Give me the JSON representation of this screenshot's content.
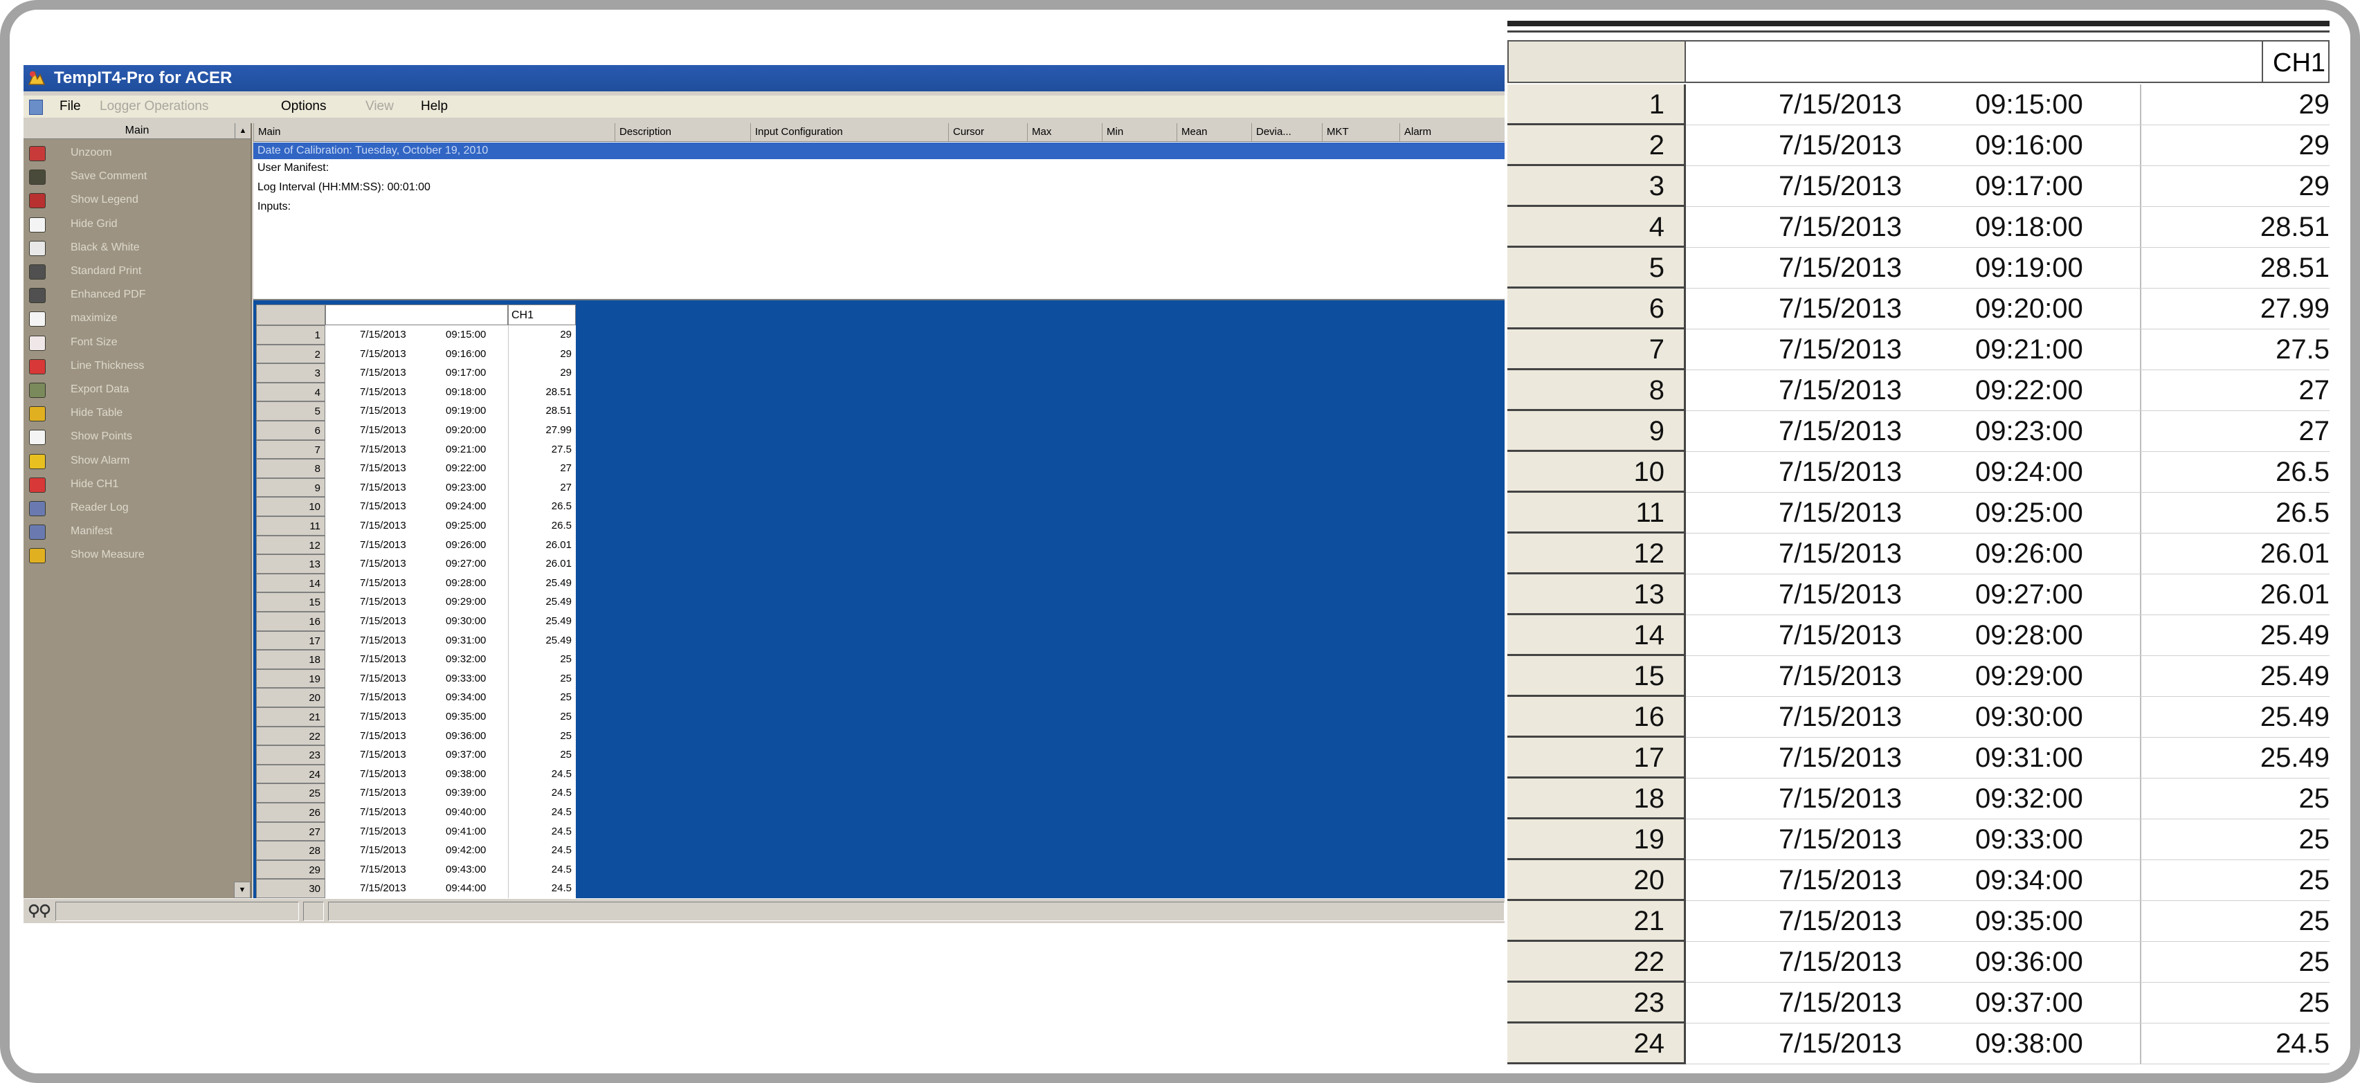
{
  "window": {
    "title": "TempIT4-Pro for ACER"
  },
  "menu": {
    "file": "File",
    "logger_operations": "Logger Operations",
    "options": "Options",
    "view": "View",
    "help": "Help"
  },
  "sidebar": {
    "header": "Main",
    "items": [
      {
        "label": "Unzoom",
        "icon": "magnifier-icon",
        "color": "#c83a3a"
      },
      {
        "label": "Save Comment",
        "icon": "comment-icon",
        "color": "#4a4a3a"
      },
      {
        "label": "Show Legend",
        "icon": "legend-icon",
        "color": "#b83030"
      },
      {
        "label": "Hide Grid",
        "icon": "grid-icon",
        "color": "#f4f4f4"
      },
      {
        "label": "Black & White",
        "icon": "black-white-icon",
        "color": "#e8e8e8"
      },
      {
        "label": "Standard Print",
        "icon": "printer-icon",
        "color": "#505050"
      },
      {
        "label": "Enhanced PDF",
        "icon": "pdf-printer-icon",
        "color": "#505050"
      },
      {
        "label": "maximize",
        "icon": "maximize-icon",
        "color": "#f4f4f4"
      },
      {
        "label": "Font Size",
        "icon": "font-size-icon",
        "color": "#f0e8e8"
      },
      {
        "label": "Line Thickness",
        "icon": "line-thickness-icon",
        "color": "#d83838"
      },
      {
        "label": "Export Data",
        "icon": "export-icon",
        "color": "#7a8a5a"
      },
      {
        "label": "Hide Table",
        "icon": "table-icon",
        "color": "#e0b020"
      },
      {
        "label": "Show Points",
        "icon": "points-icon",
        "color": "#f4f4f4"
      },
      {
        "label": "Show Alarm",
        "icon": "alarm-icon",
        "color": "#e8c020"
      },
      {
        "label": "Hide CH1",
        "icon": "channel-icon",
        "color": "#d83838"
      },
      {
        "label": "Reader Log",
        "icon": "reader-log-icon",
        "color": "#6a7ab0"
      },
      {
        "label": "Manifest",
        "icon": "manifest-icon",
        "color": "#6a7ab0"
      },
      {
        "label": "Show Measure",
        "icon": "measure-icon",
        "color": "#e0b020"
      }
    ]
  },
  "columns": [
    "Main",
    "Description",
    "Input Configuration",
    "Cursor",
    "Max",
    "Min",
    "Mean",
    "Devia...",
    "MKT",
    "Alarm"
  ],
  "info": {
    "calibration": "Date of Calibration: Tuesday, October 19, 2010",
    "manifest": "User Manifest:",
    "log_interval": "Log Interval (HH:MM:SS): 00:01:00",
    "inputs": "Inputs:"
  },
  "table": {
    "channel_header": "CH1",
    "rows": [
      {
        "n": "1",
        "date": "7/15/2013",
        "time": "09:15:00",
        "value": "29"
      },
      {
        "n": "2",
        "date": "7/15/2013",
        "time": "09:16:00",
        "value": "29"
      },
      {
        "n": "3",
        "date": "7/15/2013",
        "time": "09:17:00",
        "value": "29"
      },
      {
        "n": "4",
        "date": "7/15/2013",
        "time": "09:18:00",
        "value": "28.51"
      },
      {
        "n": "5",
        "date": "7/15/2013",
        "time": "09:19:00",
        "value": "28.51"
      },
      {
        "n": "6",
        "date": "7/15/2013",
        "time": "09:20:00",
        "value": "27.99"
      },
      {
        "n": "7",
        "date": "7/15/2013",
        "time": "09:21:00",
        "value": "27.5"
      },
      {
        "n": "8",
        "date": "7/15/2013",
        "time": "09:22:00",
        "value": "27"
      },
      {
        "n": "9",
        "date": "7/15/2013",
        "time": "09:23:00",
        "value": "27"
      },
      {
        "n": "10",
        "date": "7/15/2013",
        "time": "09:24:00",
        "value": "26.5"
      },
      {
        "n": "11",
        "date": "7/15/2013",
        "time": "09:25:00",
        "value": "26.5"
      },
      {
        "n": "12",
        "date": "7/15/2013",
        "time": "09:26:00",
        "value": "26.01"
      },
      {
        "n": "13",
        "date": "7/15/2013",
        "time": "09:27:00",
        "value": "26.01"
      },
      {
        "n": "14",
        "date": "7/15/2013",
        "time": "09:28:00",
        "value": "25.49"
      },
      {
        "n": "15",
        "date": "7/15/2013",
        "time": "09:29:00",
        "value": "25.49"
      },
      {
        "n": "16",
        "date": "7/15/2013",
        "time": "09:30:00",
        "value": "25.49"
      },
      {
        "n": "17",
        "date": "7/15/2013",
        "time": "09:31:00",
        "value": "25.49"
      },
      {
        "n": "18",
        "date": "7/15/2013",
        "time": "09:32:00",
        "value": "25"
      },
      {
        "n": "19",
        "date": "7/15/2013",
        "time": "09:33:00",
        "value": "25"
      },
      {
        "n": "20",
        "date": "7/15/2013",
        "time": "09:34:00",
        "value": "25"
      },
      {
        "n": "21",
        "date": "7/15/2013",
        "time": "09:35:00",
        "value": "25"
      },
      {
        "n": "22",
        "date": "7/15/2013",
        "time": "09:36:00",
        "value": "25"
      },
      {
        "n": "23",
        "date": "7/15/2013",
        "time": "09:37:00",
        "value": "25"
      },
      {
        "n": "24",
        "date": "7/15/2013",
        "time": "09:38:00",
        "value": "24.5"
      },
      {
        "n": "25",
        "date": "7/15/2013",
        "time": "09:39:00",
        "value": "24.5"
      },
      {
        "n": "26",
        "date": "7/15/2013",
        "time": "09:40:00",
        "value": "24.5"
      },
      {
        "n": "27",
        "date": "7/15/2013",
        "time": "09:41:00",
        "value": "24.5"
      },
      {
        "n": "28",
        "date": "7/15/2013",
        "time": "09:42:00",
        "value": "24.5"
      },
      {
        "n": "29",
        "date": "7/15/2013",
        "time": "09:43:00",
        "value": "24.5"
      },
      {
        "n": "30",
        "date": "7/15/2013",
        "time": "09:44:00",
        "value": "24.5"
      }
    ]
  },
  "colors": {
    "titlebar": "#1f4e9c",
    "selection": "#3165c4",
    "chart_area": "#0d4f9e",
    "sidebar": "#9c9382"
  }
}
